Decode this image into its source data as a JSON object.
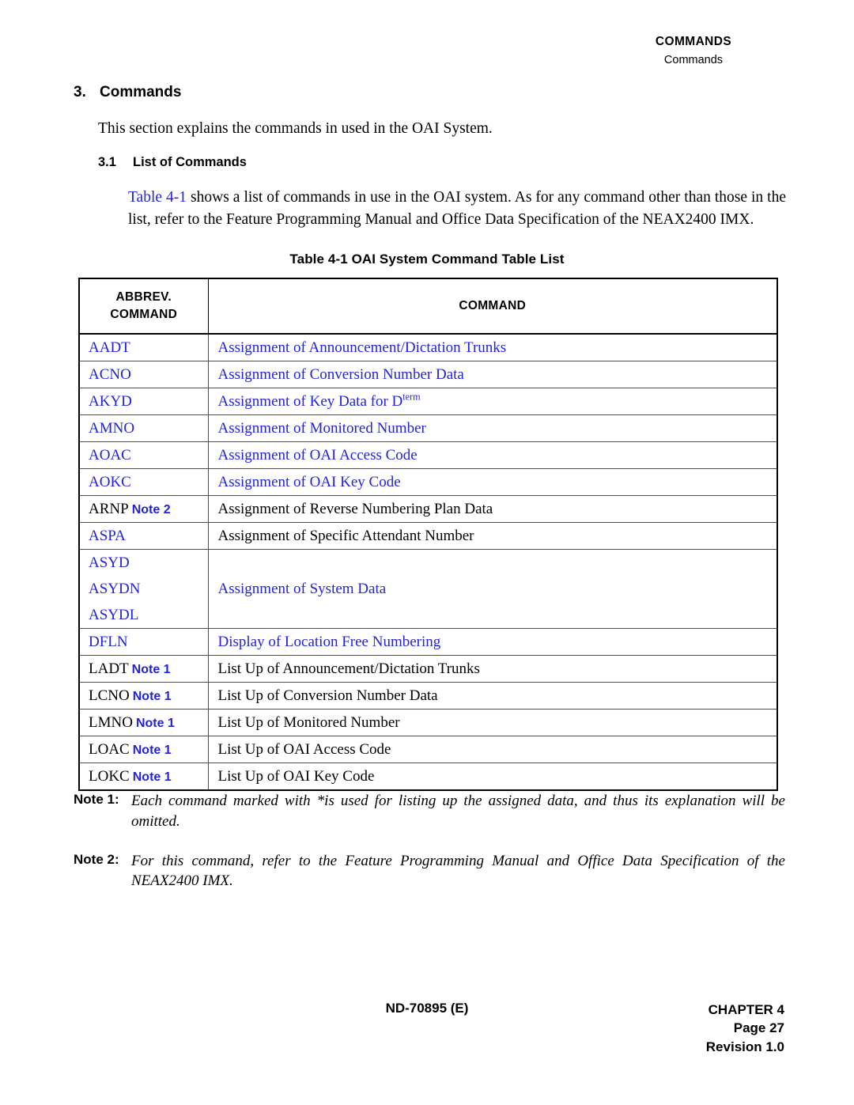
{
  "header": {
    "main": "COMMANDS",
    "sub": "Commands"
  },
  "section": {
    "number": "3.",
    "title": "Commands",
    "intro": "This section explains the commands in used in the OAI System."
  },
  "subsection": {
    "number": "3.1",
    "title": "List of Commands",
    "body_link": "Table 4-1",
    "body_rest": " shows a list of commands in use in the OAI system. As for any command other than those in the list, refer to the Feature Programming Manual and Office Data Specification of the NEAX2400 IMX."
  },
  "table": {
    "caption": "Table 4-1 OAI System Command Table List",
    "headers": {
      "col1_line1": "ABBREV.",
      "col1_line2": "COMMAND",
      "col2": "COMMAND"
    },
    "rows": [
      {
        "abbrev": "AADT",
        "abbrev_color": "blue",
        "note": "",
        "desc": "Assignment of Announcement/Dictation Trunks",
        "desc_color": "blue"
      },
      {
        "abbrev": "ACNO",
        "abbrev_color": "blue",
        "note": "",
        "desc": "Assignment of Conversion Number Data",
        "desc_color": "blue"
      },
      {
        "abbrev": "AKYD",
        "abbrev_color": "blue",
        "note": "",
        "desc": "Assignment of Key Data for D",
        "desc_sup": "term",
        "desc_color": "blue"
      },
      {
        "abbrev": "AMNO",
        "abbrev_color": "blue",
        "note": "",
        "desc": "Assignment of Monitored Number",
        "desc_color": "blue"
      },
      {
        "abbrev": "AOAC",
        "abbrev_color": "blue",
        "note": "",
        "desc": "Assignment of OAI Access Code",
        "desc_color": "blue"
      },
      {
        "abbrev": "AOKC",
        "abbrev_color": "blue",
        "note": "",
        "desc": "Assignment of OAI Key Code",
        "desc_color": "blue"
      },
      {
        "abbrev": "ARNP",
        "abbrev_color": "black",
        "note": "Note 2",
        "desc": "Assignment of Reverse Numbering Plan Data",
        "desc_color": "black"
      },
      {
        "abbrev": "ASPA",
        "abbrev_color": "blue",
        "note": "",
        "desc": "Assignment of Specific Attendant Number",
        "desc_color": "black"
      },
      {
        "abbrev_stack": [
          "ASYD",
          "ASYDN",
          "ASYDL"
        ],
        "abbrev_color": "blue",
        "note": "",
        "desc": "Assignment of System Data",
        "desc_color": "blue"
      },
      {
        "abbrev": "DFLN",
        "abbrev_color": "blue",
        "note": "",
        "desc": "Display of Location Free Numbering",
        "desc_color": "blue"
      },
      {
        "abbrev": "LADT",
        "abbrev_color": "black",
        "note": "Note 1",
        "desc": "List Up of Announcement/Dictation Trunks",
        "desc_color": "black"
      },
      {
        "abbrev": "LCNO",
        "abbrev_color": "black",
        "note": "Note 1",
        "desc": "List Up of Conversion Number Data",
        "desc_color": "black"
      },
      {
        "abbrev": "LMNO",
        "abbrev_color": "black",
        "note": "Note 1",
        "desc": "List Up of Monitored Number",
        "desc_color": "black"
      },
      {
        "abbrev": "LOAC",
        "abbrev_color": "black",
        "note": "Note 1",
        "desc": "List Up of OAI Access Code",
        "desc_color": "black"
      },
      {
        "abbrev": "LOKC",
        "abbrev_color": "black",
        "note": "Note 1",
        "desc": "List Up of OAI Key Code",
        "desc_color": "black"
      }
    ]
  },
  "notes": [
    {
      "label": "Note 1:",
      "text": "Each command marked with *is used for listing up the assigned data, and thus its explanation will be omitted."
    },
    {
      "label": "Note 2:",
      "text": "For this command, refer to the Feature Programming Manual and Office Data Specification of the NEAX2400 IMX."
    }
  ],
  "footer": {
    "doc_id": "ND-70895 (E)",
    "chapter": "CHAPTER 4",
    "page": "Page 27",
    "revision": "Revision 1.0"
  },
  "colors": {
    "link_blue": "#2222dd",
    "text_black": "#000000"
  }
}
